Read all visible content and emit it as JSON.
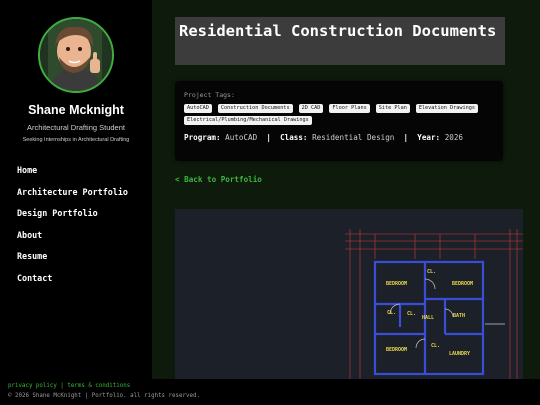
{
  "sidebar": {
    "name": "Shane Mcknight",
    "role": "Architectural Drafting Student",
    "seeking": "Seeking Internships in Architectural Drafting",
    "nav": [
      "Home",
      "Architecture Portfolio",
      "Design Portfolio",
      "About",
      "Resume",
      "Contact"
    ]
  },
  "main": {
    "title": "Residential Construction Documents",
    "tags_label": "Project Tags:",
    "tags": [
      "AutoCAD",
      "Construction Documents",
      "2D CAD",
      "Floor Plans",
      "Site Plan",
      "Elevation Drawings",
      "Electrical/Plumbing/Mechanical Drawings"
    ],
    "meta": {
      "program_label": "Program:",
      "program": "AutoCAD",
      "class_label": "Class:",
      "class": "Residential Design",
      "year_label": "Year:",
      "year": "2026",
      "sep": "|"
    },
    "back_link": "< Back to Portfolio",
    "plan_labels": {
      "bedroom1": "BEDROOM",
      "bedroom2": "BEDROOM",
      "bedroom3": "BEDROOM",
      "cl1": "CL.",
      "cl2": "CL.",
      "cl3": "CL.",
      "cl4": "CL.",
      "hall": "HALL",
      "bath": "BATH",
      "laundry": "LAUNDRY"
    }
  },
  "footer": {
    "privacy": "privacy policy",
    "terms": "terms & conditions",
    "divider": "|",
    "copyright": "© 2026 Shane McKnight | Portfolio. all rights reserved."
  },
  "colors": {
    "accent": "#3db83d",
    "background": "#0e1a0c",
    "plan_bg": "#1c2129"
  }
}
